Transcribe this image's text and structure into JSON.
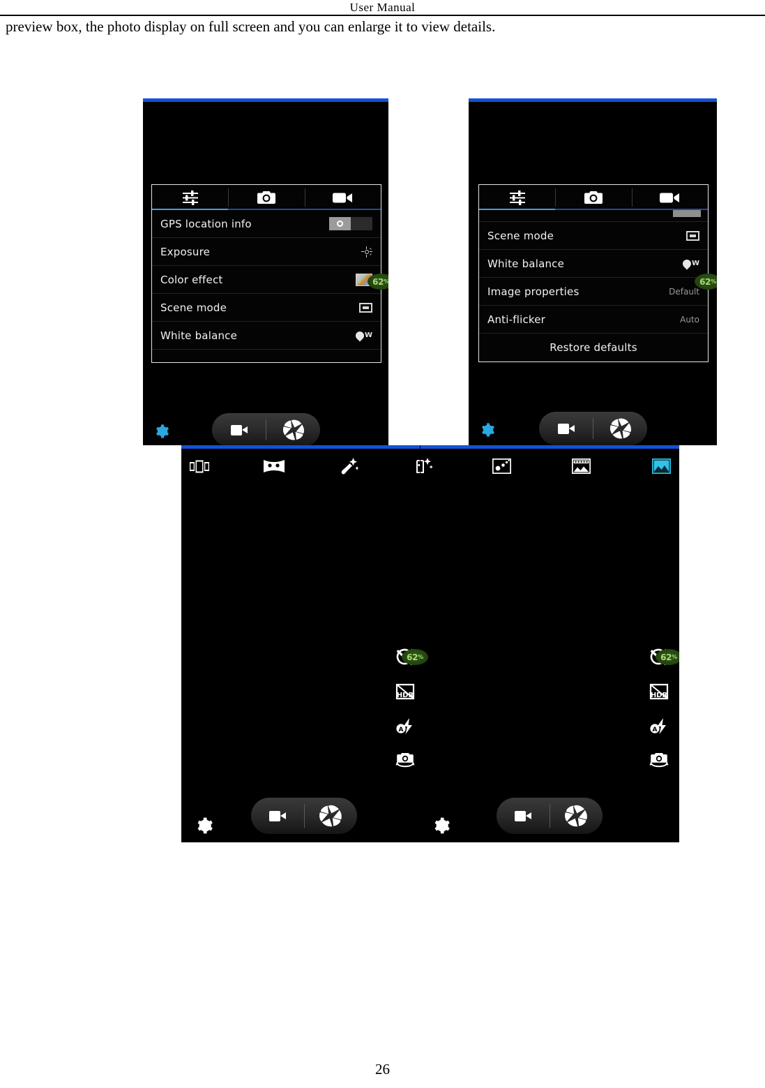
{
  "document": {
    "header": "User   Manual",
    "body_text": "preview box, the photo display on full screen and you can enlarge it to view details.",
    "page_number": "26"
  },
  "colors": {
    "statusbar_blue": "#1352d8",
    "tab_active_blue": "#3fa0ee",
    "tab_rule_blue": "#1b4f96",
    "battery_green_bg": "#24460f",
    "battery_green_text": "#a8d97a",
    "gear_blue": "#2aa8e0",
    "gear_white": "#ffffff",
    "highlight_cyan": "#2fc3e8"
  },
  "screenshot_1": {
    "name": "camera-settings-general-top",
    "tabs": [
      {
        "label": "",
        "icon": "sliders-icon",
        "active": true
      },
      {
        "label": "",
        "icon": "camera-icon",
        "active": false
      },
      {
        "label": "",
        "icon": "video-camera-icon",
        "active": false
      }
    ],
    "rows": [
      {
        "label": "GPS location info",
        "control": "toggle",
        "value": "",
        "state": "off"
      },
      {
        "label": "Exposure",
        "control": "icon",
        "icon": "exposure-sun-icon",
        "value": ""
      },
      {
        "label": "Color effect",
        "control": "icon",
        "icon": "color-effect-thumbnail-icon",
        "value": ""
      },
      {
        "label": "Scene mode",
        "control": "icon",
        "icon": "scene-mode-icon",
        "value": ""
      },
      {
        "label": "White balance",
        "control": "icon",
        "icon": "white-balance-icon",
        "value": ""
      }
    ],
    "battery": {
      "text": "62",
      "unit": "%"
    },
    "bottom": {
      "settings_icon": "gear-icon",
      "video_button": "video-camera-icon",
      "shutter_button": "shutter-aperture-icon"
    }
  },
  "screenshot_2": {
    "name": "camera-settings-general-scrolled",
    "tabs": [
      {
        "label": "",
        "icon": "sliders-icon",
        "active": true
      },
      {
        "label": "",
        "icon": "camera-icon",
        "active": false
      },
      {
        "label": "",
        "icon": "video-camera-icon",
        "active": false
      }
    ],
    "rows": [
      {
        "label": "Scene mode",
        "control": "icon",
        "icon": "scene-mode-icon",
        "value": ""
      },
      {
        "label": "White balance",
        "control": "icon",
        "icon": "white-balance-icon",
        "value": ""
      },
      {
        "label": "Image properties",
        "control": "text",
        "value": "Default"
      },
      {
        "label": "Anti-flicker",
        "control": "text",
        "value": "Auto"
      },
      {
        "label": "Restore defaults",
        "control": "action",
        "value": ""
      }
    ],
    "battery": {
      "text": "62",
      "unit": "%"
    },
    "bottom": {
      "settings_icon": "gear-icon",
      "video_button": "video-camera-icon",
      "shutter_button": "shutter-aperture-icon"
    }
  },
  "screenshot_3": {
    "name": "camera-capture-modes-pair",
    "mode_bar": [
      {
        "icon": "multi-angle-view-icon",
        "label": "Multi Angle View",
        "active": false
      },
      {
        "icon": "panorama-icon",
        "label": "Panorama",
        "active": false
      },
      {
        "icon": "face-beauty-icon",
        "label": "Face Beauty",
        "active": false
      },
      {
        "icon": "live-photo-icon",
        "label": "Live Photo",
        "active": false
      },
      {
        "icon": "motion-track-icon",
        "label": "Motion Track",
        "active": false
      },
      {
        "icon": "multi-angle-shot-icon",
        "label": "Multi Shot",
        "active": false
      },
      {
        "icon": "normal-photo-icon",
        "label": "Normal",
        "active": true
      }
    ],
    "left_panel": {
      "rail": [
        {
          "icon": "reset-rotate-icon",
          "label": "Reset"
        },
        {
          "icon": "hdr-off-icon",
          "label": "HDR Off"
        },
        {
          "icon": "flash-auto-icon",
          "label": "Flash Auto"
        },
        {
          "icon": "switch-camera-icon",
          "label": "Switch Camera"
        }
      ],
      "battery": {
        "text": "62",
        "unit": "%"
      },
      "bottom": {
        "settings_icon": "gear-icon",
        "video_button": "video-camera-icon",
        "shutter_button": "shutter-aperture-icon"
      }
    },
    "right_panel": {
      "rail": [
        {
          "icon": "reset-rotate-icon",
          "label": "Reset"
        },
        {
          "icon": "hdr-off-icon",
          "label": "HDR Off"
        },
        {
          "icon": "flash-auto-icon",
          "label": "Flash Auto"
        },
        {
          "icon": "switch-camera-icon",
          "label": "Switch Camera"
        }
      ],
      "battery": {
        "text": "62",
        "unit": "%"
      },
      "bottom": {
        "settings_icon": "gear-icon",
        "video_button": "video-camera-icon",
        "shutter_button": "shutter-aperture-icon"
      }
    }
  }
}
